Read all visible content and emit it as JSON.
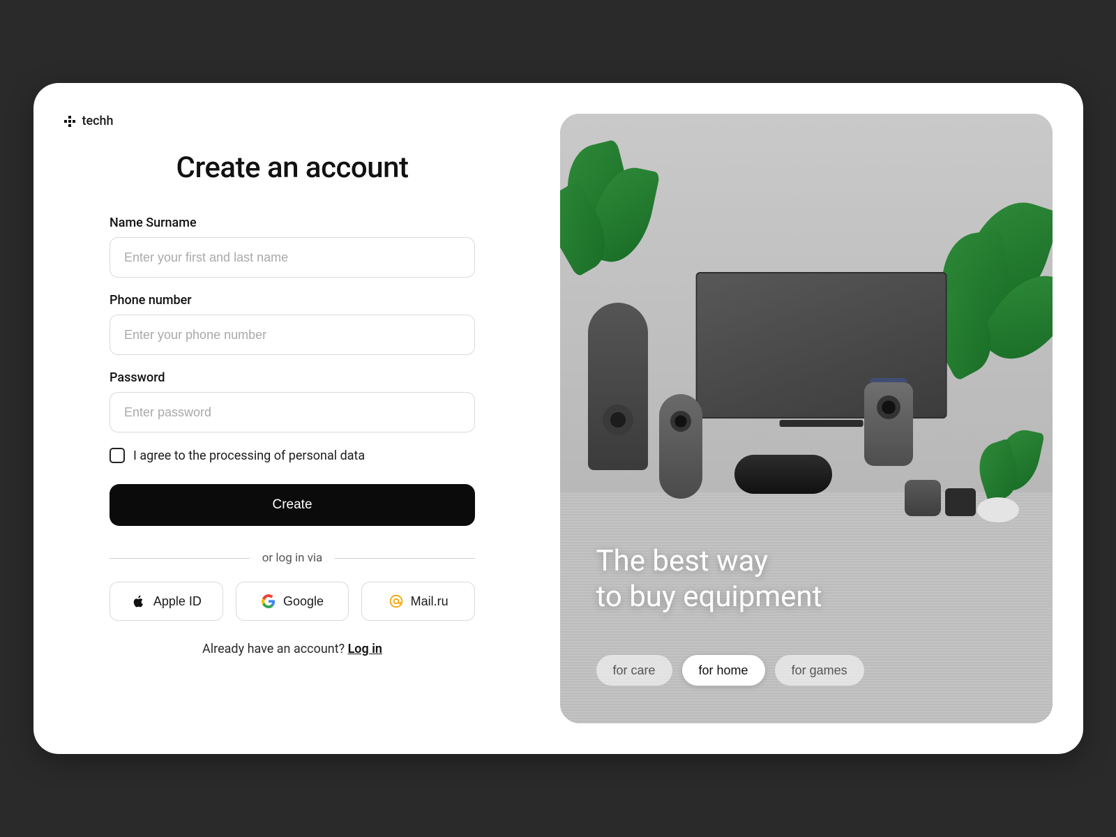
{
  "brand": {
    "name": "techh"
  },
  "form": {
    "title": "Create an account",
    "name_label": "Name Surname",
    "name_placeholder": "Enter your first and last name",
    "phone_label": "Phone number",
    "phone_placeholder": "Enter your phone number",
    "password_label": "Password",
    "password_placeholder": "Enter password",
    "consent_text": "I agree to the processing of personal data",
    "submit_label": "Create",
    "divider_text": "or log in via",
    "social": {
      "apple": "Apple ID",
      "google": "Google",
      "mailru": "Mail.ru"
    },
    "login_prompt": "Already have an account? ",
    "login_link": "Log in"
  },
  "hero": {
    "line1": "The best way",
    "line2": "to buy equipment",
    "pills": {
      "care": "for care",
      "home": "for home",
      "games": "for games"
    }
  }
}
